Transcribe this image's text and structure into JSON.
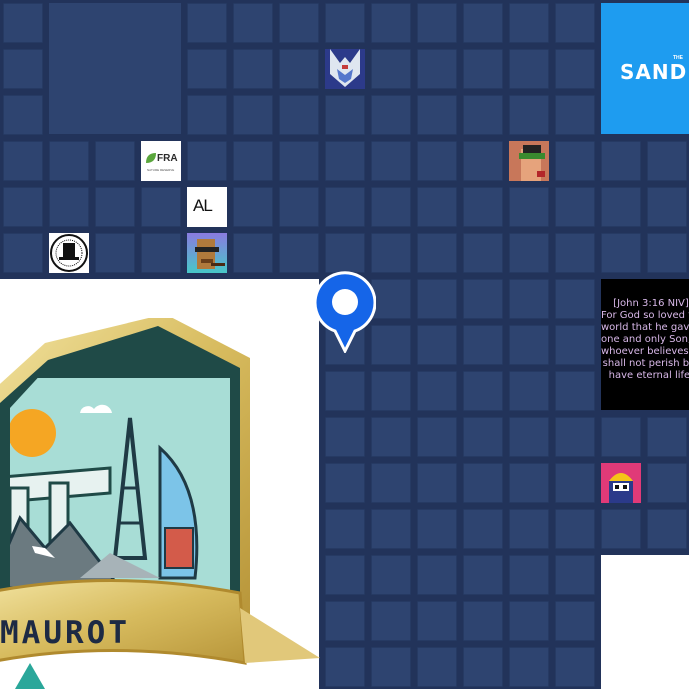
{
  "map": {
    "parcels": [
      {
        "name": "sandbox-parcel",
        "label": "SANDBOX",
        "small_label": "THE"
      },
      {
        "name": "verse-parcel",
        "lines": [
          "[John 3:16 NIV]",
          "For God so loved the",
          "world that he gave his",
          "one and only Son, that",
          "whoever believes in him",
          "shall not perish but",
          "have eternal life."
        ]
      },
      {
        "name": "fra-logo-parcel",
        "label": "FRA",
        "sublabel": "NATURE RESERVE"
      },
      {
        "name": "al-logo-parcel",
        "label": "AL"
      },
      {
        "name": "badge-estate",
        "label": "MAUROT"
      }
    ],
    "thumbnails": [
      "robot-helmet-thumbnail",
      "punk-avatar-thumbnail",
      "top-hat-logo-thumbnail",
      "pixel-ape-thumbnail",
      "hardhat-character-thumbnail"
    ]
  },
  "colors": {
    "background": "#22335a",
    "cell": "#2e4470",
    "sandbox": "#1e9cf0",
    "pin": "#1565e8",
    "verse_text": "#d8b8e8"
  },
  "pin": {
    "icon": "location-pin-icon"
  }
}
